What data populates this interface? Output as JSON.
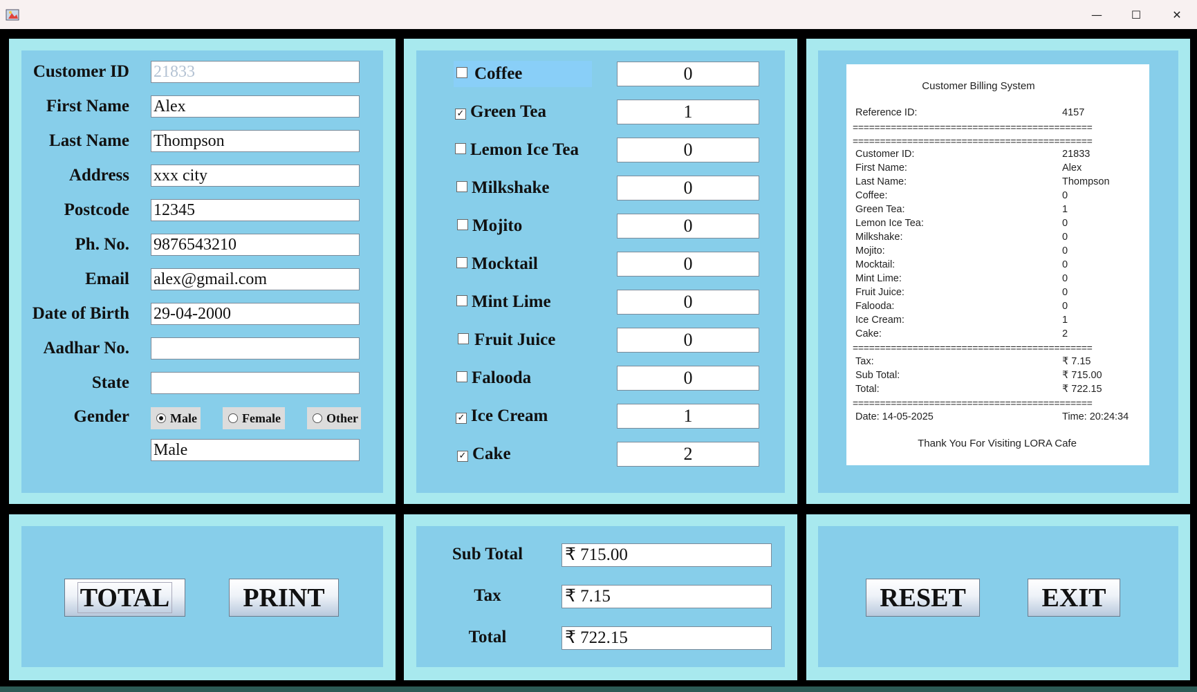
{
  "window": {
    "minimize": "—",
    "maximize": "☐",
    "close": "✕"
  },
  "customer_form": {
    "fields": [
      {
        "label": "Customer ID",
        "value": "21833"
      },
      {
        "label": "First Name",
        "value": "Alex"
      },
      {
        "label": "Last Name",
        "value": "Thompson"
      },
      {
        "label": "Address",
        "value": "xxx city"
      },
      {
        "label": "Postcode",
        "value": "12345"
      },
      {
        "label": "Ph. No.",
        "value": "9876543210"
      },
      {
        "label": "Email",
        "value": "alex@gmail.com"
      },
      {
        "label": "Date of Birth",
        "value": "29-04-2000"
      },
      {
        "label": "Aadhar No.",
        "value": ""
      },
      {
        "label": "State",
        "value": ""
      }
    ],
    "gender_label": "Gender",
    "gender_options": [
      "Male",
      "Female",
      "Other"
    ],
    "gender_selected": "Male",
    "gender_value": "Male"
  },
  "menu": {
    "items": [
      {
        "name": "Coffee",
        "checked": false,
        "qty": "0"
      },
      {
        "name": "Green Tea",
        "checked": true,
        "qty": "1"
      },
      {
        "name": "Lemon Ice Tea",
        "checked": false,
        "qty": "0"
      },
      {
        "name": "Milkshake",
        "checked": false,
        "qty": "0"
      },
      {
        "name": "Mojito",
        "checked": false,
        "qty": "0"
      },
      {
        "name": "Mocktail",
        "checked": false,
        "qty": "0"
      },
      {
        "name": "Mint Lime",
        "checked": false,
        "qty": "0"
      },
      {
        "name": "Fruit Juice",
        "checked": false,
        "qty": "0"
      },
      {
        "name": "Falooda",
        "checked": false,
        "qty": "0"
      },
      {
        "name": "Ice Cream",
        "checked": true,
        "qty": "1"
      },
      {
        "name": "Cake",
        "checked": true,
        "qty": "2"
      }
    ]
  },
  "receipt": {
    "title": "Customer Billing System",
    "reference": {
      "label": "Reference ID:",
      "value": "4157"
    },
    "separator": "============================================",
    "customer_rows": [
      {
        "label": "Customer ID:",
        "value": "21833"
      },
      {
        "label": "First Name:",
        "value": "Alex"
      },
      {
        "label": "Last Name:",
        "value": "Thompson"
      },
      {
        "label": "Coffee:",
        "value": "0"
      },
      {
        "label": "Green Tea:",
        "value": "1"
      },
      {
        "label": "Lemon Ice Tea:",
        "value": "0"
      },
      {
        "label": "Milkshake:",
        "value": "0"
      },
      {
        "label": "Mojito:",
        "value": "0"
      },
      {
        "label": "Mocktail:",
        "value": "0"
      },
      {
        "label": "Mint Lime:",
        "value": "0"
      },
      {
        "label": "Fruit Juice:",
        "value": "0"
      },
      {
        "label": "Falooda:",
        "value": "0"
      },
      {
        "label": "Ice Cream:",
        "value": "1"
      },
      {
        "label": "Cake:",
        "value": "2"
      }
    ],
    "totals_rows": [
      {
        "label": "Tax:",
        "value": "₹ 7.15"
      },
      {
        "label": "Sub Total:",
        "value": "₹ 715.00"
      },
      {
        "label": "Total:",
        "value": "₹ 722.15"
      }
    ],
    "date": "Date: 14-05-2025",
    "time": "Time: 20:24:34",
    "footer": "Thank You For Visiting LORA Cafe"
  },
  "actions": {
    "total": "TOTAL",
    "print": "PRINT",
    "reset": "RESET",
    "exit": "EXIT"
  },
  "totals": {
    "subtotal_label": "Sub Total",
    "subtotal": "₹ 715.00",
    "tax_label": "Tax",
    "tax": "₹ 7.15",
    "total_label": "Total",
    "total": "₹ 722.15"
  }
}
